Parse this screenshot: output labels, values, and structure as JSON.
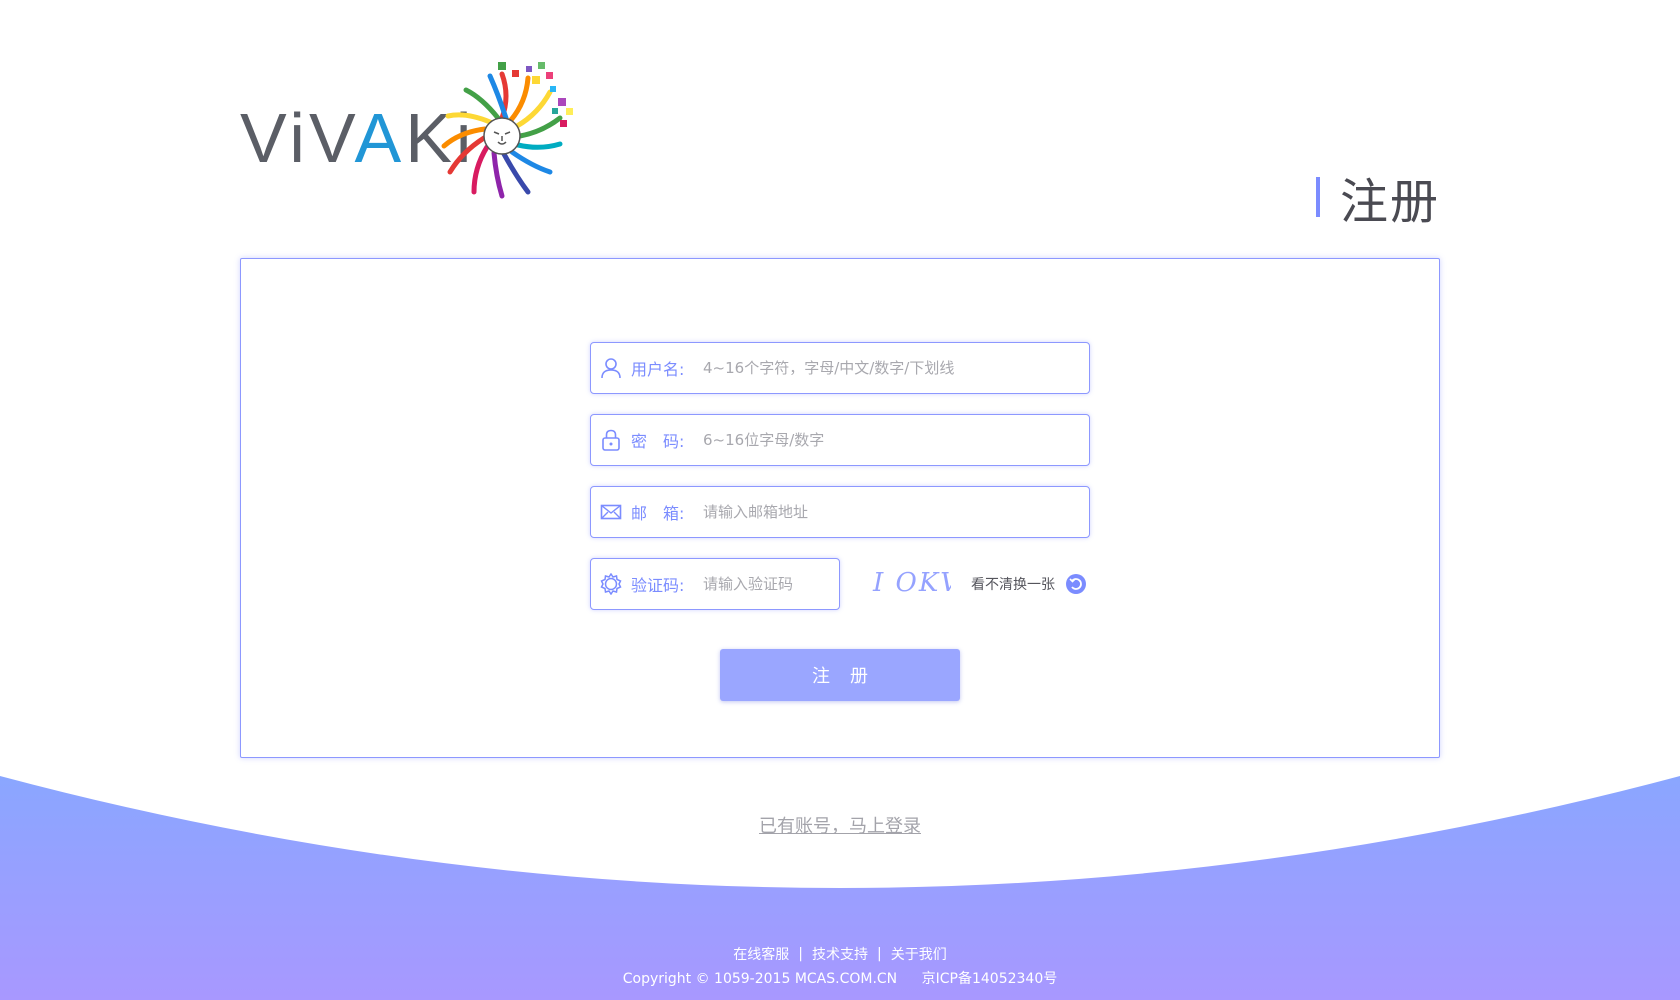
{
  "brand": {
    "logo_text_pre": "ViV",
    "logo_text_accent": "A",
    "logo_text_post": "Ki",
    "accent_color": "#7b8cff",
    "wave_color": "#96a8ff"
  },
  "page_title": "注册",
  "form": {
    "username": {
      "label": "用户名:",
      "placeholder": "4~16个字符，字母/中文/数字/下划线",
      "icon": "user-icon"
    },
    "password": {
      "label": "密　码:",
      "placeholder": "6~16位字母/数字",
      "icon": "lock-icon"
    },
    "email": {
      "label": "邮　箱:",
      "placeholder": "请输入邮箱地址",
      "icon": "mail-icon"
    },
    "captcha": {
      "label": "验证码:",
      "placeholder": "请输入验证码",
      "icon": "gear-icon",
      "image_text": "I OKV",
      "refresh_label": "看不清换一张"
    },
    "submit_label": "注册"
  },
  "login_link": "已有账号，马上登录",
  "footer": {
    "links": [
      "在线客服",
      "技术支持",
      "关于我们"
    ],
    "separator": "|",
    "copyright": "Copyright © 1059-2015 MCAS.COM.CN",
    "icp": "京ICP备14052340号"
  }
}
